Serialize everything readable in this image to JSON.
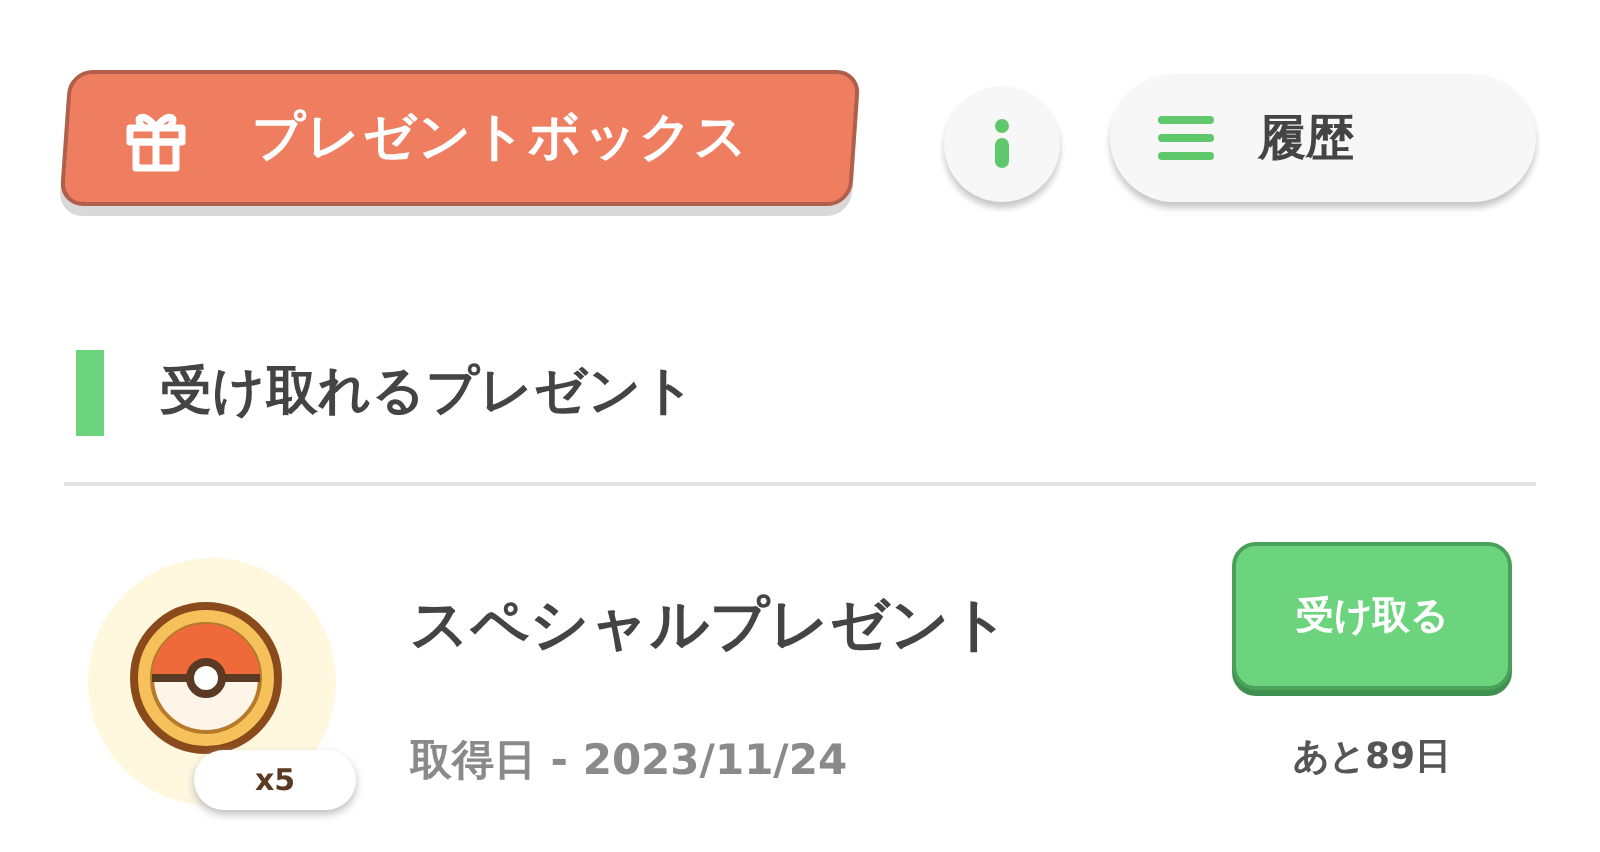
{
  "header": {
    "title_button": "プレゼントボックス",
    "history_button": "履歴"
  },
  "section": {
    "title": "受け取れるプレゼント"
  },
  "presents": [
    {
      "name": "スペシャルプレゼント",
      "count": "x5",
      "date": "取得日 - 2023/11/24",
      "action": "受け取る",
      "remaining": "あと89日"
    }
  ]
}
